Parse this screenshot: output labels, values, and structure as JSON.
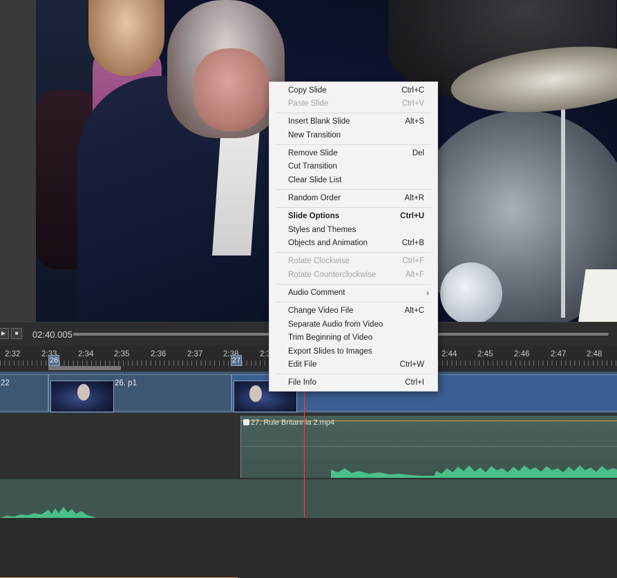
{
  "transport": {
    "play_icon": "play-icon",
    "stop_icon": "stop-icon",
    "time": "02:40.005"
  },
  "ruler": {
    "ticks": [
      "2:32",
      "2:33",
      "2:34",
      "2:35",
      "2:36",
      "2:37",
      "2:38",
      "2:3",
      "2:44",
      "2:45",
      "2:46",
      "2:47",
      "2:48"
    ],
    "markers": [
      "26",
      "27"
    ]
  },
  "slides": {
    "left_fragment": "22",
    "slide26_label": "26. p1"
  },
  "audio": {
    "clip_label": "27. Rule Britannia 2.mp4",
    "clip_icon": "audio-clip-icon"
  },
  "colors": {
    "slide_track": "#3d5671",
    "audio_wave": "#49c089",
    "volume_line": "#e59b46",
    "playhead": "#d64a4a",
    "marker": "#5a6f8c"
  },
  "context_menu": {
    "items": [
      {
        "label": "Copy Slide",
        "shortcut": "Ctrl+C"
      },
      {
        "label": "Paste Slide",
        "shortcut": "Ctrl+V"
      },
      {
        "label": "Insert Blank Slide",
        "shortcut": "Alt+S"
      },
      {
        "label": "New Transition",
        "shortcut": ""
      },
      {
        "label": "Remove Slide",
        "shortcut": "Del"
      },
      {
        "label": "Cut Transition",
        "shortcut": ""
      },
      {
        "label": "Clear Slide List",
        "shortcut": ""
      },
      {
        "label": "Random Order",
        "shortcut": "Alt+R"
      },
      {
        "label": "Slide Options",
        "shortcut": "Ctrl+U"
      },
      {
        "label": "Styles and Themes",
        "shortcut": ""
      },
      {
        "label": "Objects and Animation",
        "shortcut": "Ctrl+B"
      },
      {
        "label": "Rotate Clockwise",
        "shortcut": "Ctrl+F"
      },
      {
        "label": "Rotate Counterclockwise",
        "shortcut": "Alt+F"
      },
      {
        "label": "Audio Comment",
        "shortcut": ""
      },
      {
        "label": "Change Video File",
        "shortcut": "Alt+C"
      },
      {
        "label": "Separate Audio from Video",
        "shortcut": ""
      },
      {
        "label": "Trim Beginning of Video",
        "shortcut": ""
      },
      {
        "label": "Export Slides to Images",
        "shortcut": ""
      },
      {
        "label": "Edit File",
        "shortcut": "Ctrl+W"
      },
      {
        "label": "File Info",
        "shortcut": "Ctrl+I"
      }
    ],
    "submenu_arrow": "›"
  }
}
